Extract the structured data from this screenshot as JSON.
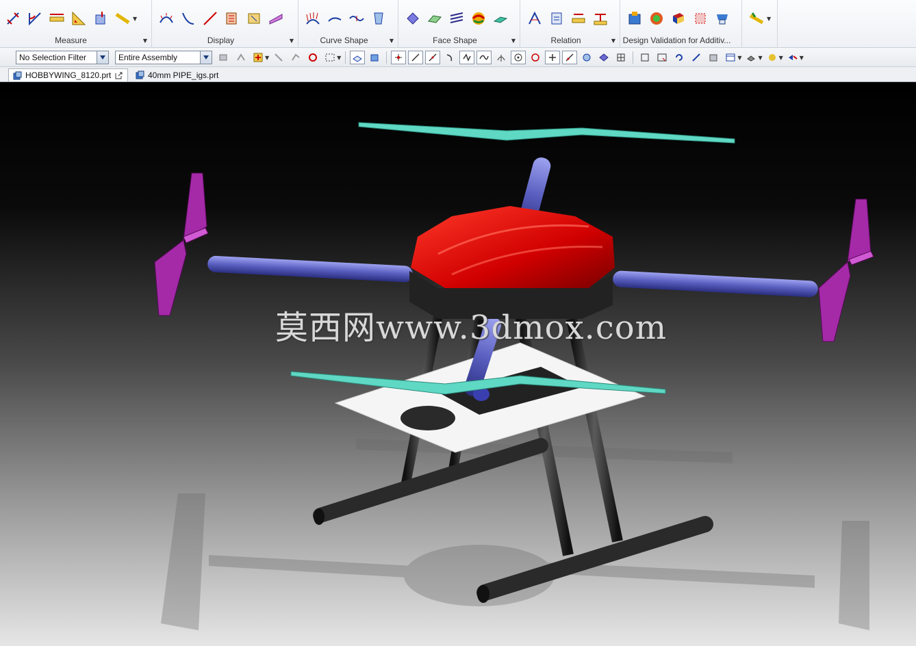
{
  "ribbon": {
    "groups": [
      {
        "label": "Measure",
        "icons": [
          "measure-distance-icon",
          "measure-angle-icon",
          "measure-length-icon",
          "measure-area-icon",
          "measure-body-icon",
          "ruler-icon"
        ]
      },
      {
        "label": "Display",
        "icons": [
          "curve-curvature-icon",
          "curve-comb-icon",
          "line-icon",
          "section-analysis-icon",
          "face-analysis-icon",
          "draft-analysis-icon"
        ]
      },
      {
        "label": "Curve Shape",
        "icons": [
          "curve-comb-shape-icon",
          "curve-peak-icon",
          "inflection-icon",
          "curve-analysis-icon"
        ]
      },
      {
        "label": "Face Shape",
        "icons": [
          "face-radius-icon",
          "face-normal-icon",
          "reflection-icon",
          "face-curvature-icon",
          "slope-icon"
        ]
      },
      {
        "label": "Relation",
        "icons": [
          "deviation-gauge-icon",
          "distance-relation-icon",
          "gap-icon",
          "clearance-icon"
        ]
      },
      {
        "label": "Design Validation for Additiv...",
        "icons": [
          "am-part-icon",
          "am-thickness-icon",
          "am-overhang-icon",
          "am-support-icon",
          "am-print-icon"
        ]
      },
      {
        "label": "",
        "icons": [
          "more-tools-icon"
        ]
      }
    ]
  },
  "selection_bar": {
    "filter_value": "No Selection Filter",
    "scope_value": "Entire Assembly"
  },
  "tabs": [
    {
      "label": "HOBBYWING_8120.prt"
    },
    {
      "label": "40mm PIPE_igs.prt"
    }
  ],
  "viewport": {
    "watermark": "莫西网www.3dmox.com",
    "colors": {
      "hub": "#e00000",
      "arm": "#5a5fc0",
      "prop_cyan": "#5fd8c4",
      "prop_magenta": "#a42aa8",
      "gear": "#2a2a2a"
    }
  }
}
